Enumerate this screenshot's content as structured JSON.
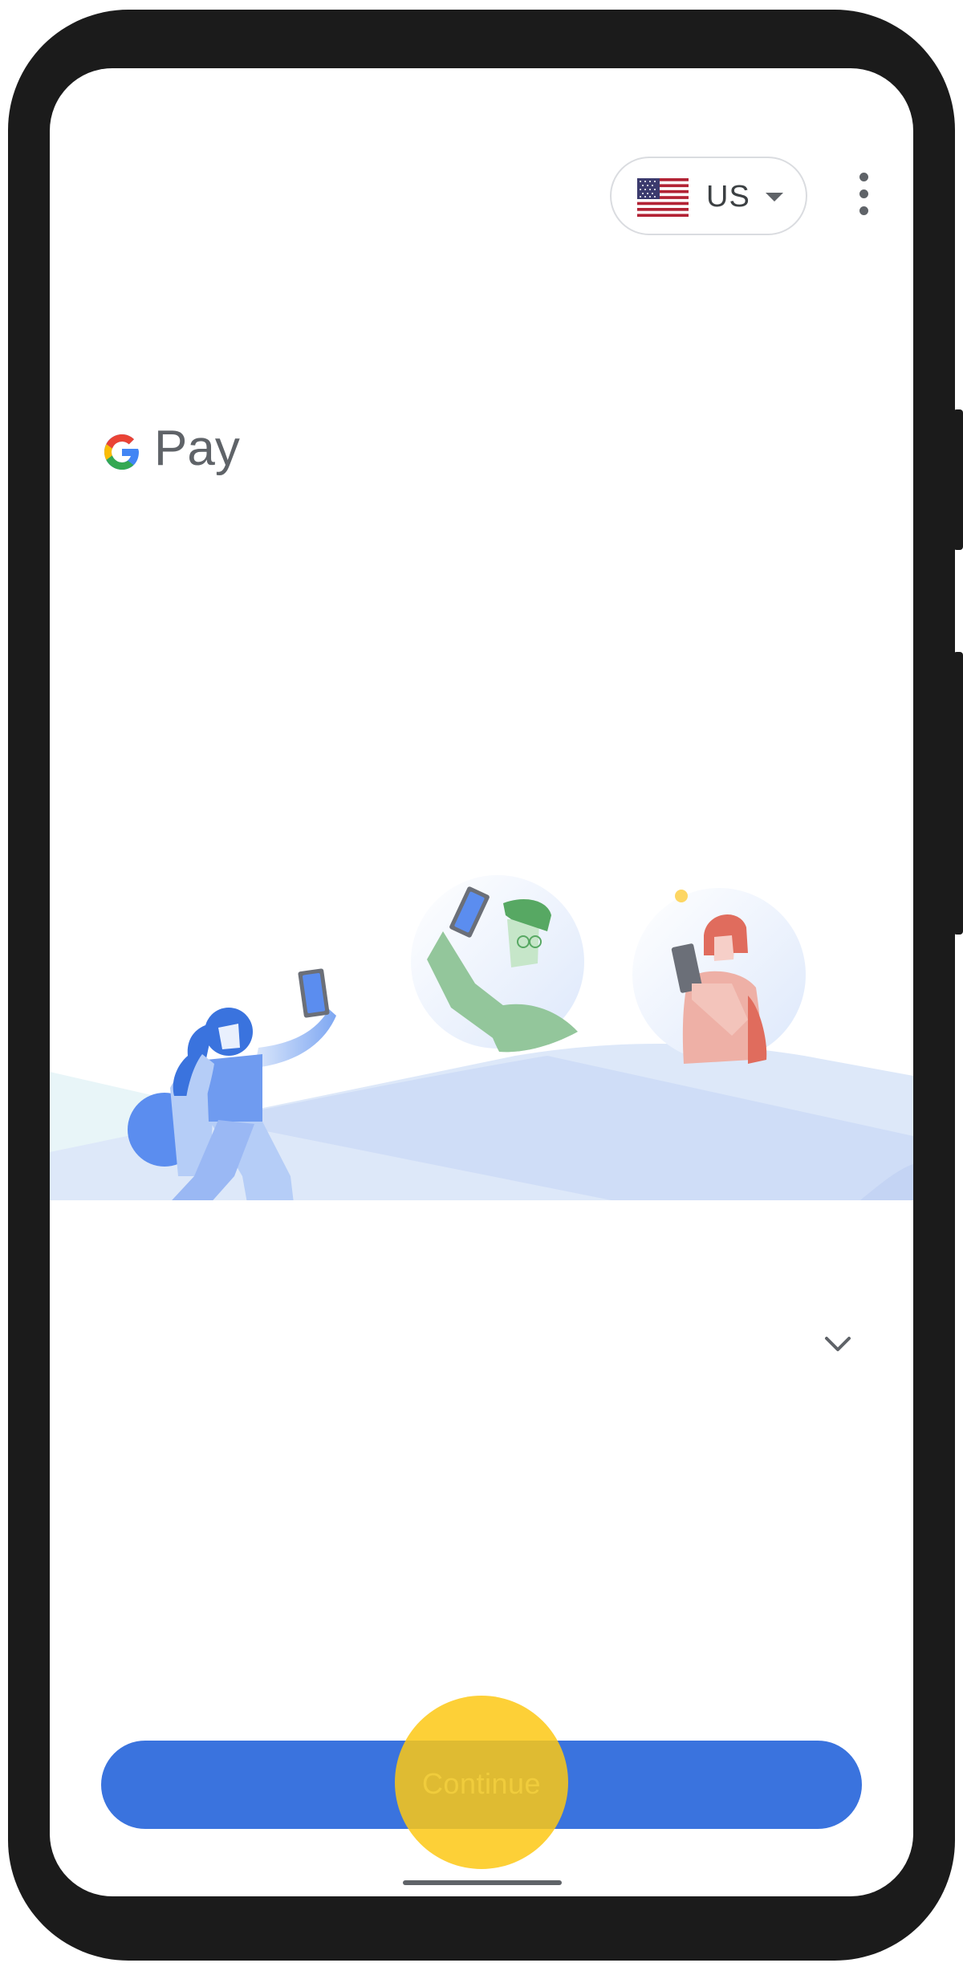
{
  "language_selector": {
    "code": "US",
    "flag": "us-flag-icon"
  },
  "menu": {
    "icon": "more-vert-icon"
  },
  "brand": {
    "logo_text": "Pay",
    "logo_icon": "google-g-icon"
  },
  "illustration": {
    "icon": "people-sending-money-illustration"
  },
  "expand": {
    "icon": "chevron-down-icon"
  },
  "primary_action": {
    "label": "Continue"
  },
  "colors": {
    "primary": "#3a73de",
    "tap_indicator": "#fdc814",
    "text_secondary": "#5f6368"
  }
}
